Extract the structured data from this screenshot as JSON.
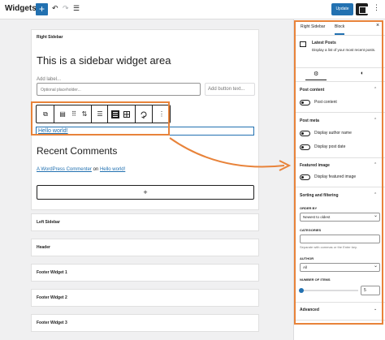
{
  "topbar": {
    "title": "Widgets",
    "add": "+",
    "undo": "↶",
    "redo": "↷",
    "list_view": "☰",
    "update": "Update",
    "more": "⋮"
  },
  "canvas": {
    "main_area": {
      "title": "Right Sidebar",
      "heading": "This is a sidebar widget area",
      "add_label": "Add label...",
      "input_placeholder": "Optional placeholder...",
      "add_button_text": "Add button text...",
      "link_text": "Hello world!",
      "recent_heading": "Recent Comments",
      "commenter": "A WordPress Commenter",
      "on": "on",
      "post_link": "Hello world!",
      "add_block": "+"
    },
    "collapsed_areas": [
      "Left Sidebar",
      "Header",
      "Footer Widget 1",
      "Footer Widget 2",
      "Footer Widget 3"
    ]
  },
  "block_toolbar": {
    "transform": "⧉",
    "block_type": "▤",
    "drag": "⠿",
    "move": "⇅",
    "align": "☰",
    "more": "⋮"
  },
  "sidebar": {
    "tabs": [
      "Right Sidebar",
      "Block"
    ],
    "close": "×",
    "block_name": "Latest Posts",
    "block_desc": "Display a list of your most recent posts.",
    "style_tabs": [
      "⚙",
      "◐"
    ],
    "panels": {
      "post_content": {
        "title": "Post content",
        "toggle": "Post content"
      },
      "post_meta": {
        "title": "Post meta",
        "toggles": [
          "Display author name",
          "Display post date"
        ]
      },
      "featured_image": {
        "title": "Featured image",
        "toggle": "Display featured image"
      },
      "sorting": {
        "title": "Sorting and filtering",
        "order_by_label": "ORDER BY",
        "order_by_value": "Newest to oldest",
        "categories_label": "CATEGORIES",
        "categories_help": "Separate with commas or the Enter key.",
        "author_label": "AUTHOR",
        "author_value": "All",
        "items_label": "NUMBER OF ITEMS",
        "items_value": "5",
        "items_fraction": 0.0
      },
      "advanced": {
        "title": "Advanced"
      }
    }
  },
  "colors": {
    "accent": "#2271b1",
    "highlight": "#e8833a"
  }
}
